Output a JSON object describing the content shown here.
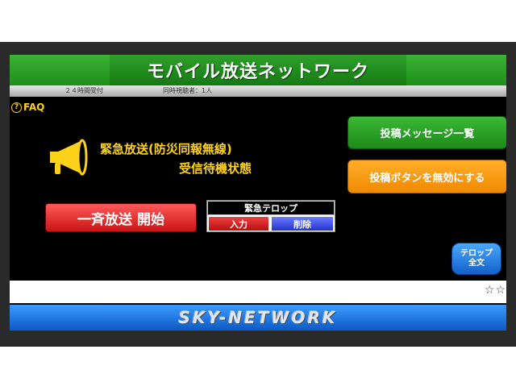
{
  "app": {
    "title": "モバイル放送ネットワーク"
  },
  "info_bar": {
    "hours": "２４時間受付",
    "listeners": "同時視聴者：1人"
  },
  "faq": {
    "icon": "question-circle-icon",
    "label": "FAQ"
  },
  "status": {
    "icon": "megaphone-icon",
    "line1": "緊急放送(防災同報無線)",
    "line2": "受信待機状態"
  },
  "buttons": {
    "message_list": "投稿メッセージ一覧",
    "disable_post": "投稿ボタンを無効にする",
    "broadcast_start": "一斉放送 開始",
    "telop_full_line1": "テロップ",
    "telop_full_line2": "全文"
  },
  "telop": {
    "label": "緊急テロップ",
    "input": "入力",
    "delete": "削除"
  },
  "ticker": {
    "stars": "☆☆"
  },
  "footer": {
    "brand": "SKY-NETWORK"
  },
  "colors": {
    "title_green": "#1f8f1c",
    "accent_yellow": "#ffd21a",
    "orange": "#f08a00",
    "red": "#c91414",
    "blue": "#0f58c4"
  }
}
